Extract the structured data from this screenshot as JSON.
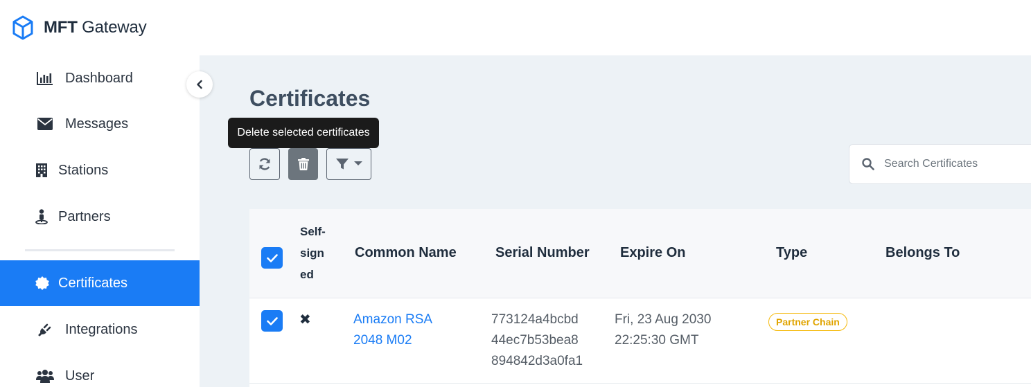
{
  "app": {
    "brand_bold": "MFT",
    "brand_rest": " Gateway"
  },
  "sidebar": {
    "items": [
      {
        "label": "Dashboard",
        "icon": "bar-chart-icon"
      },
      {
        "label": "Messages",
        "icon": "envelope-icon"
      },
      {
        "label": "Stations",
        "icon": "building-icon"
      },
      {
        "label": "Partners",
        "icon": "person-pin-icon"
      },
      {
        "label": "Certificates",
        "icon": "certificate-icon",
        "active": true
      },
      {
        "label": "Integrations",
        "icon": "plug-icon"
      },
      {
        "label": "User",
        "icon": "users-icon"
      }
    ]
  },
  "main": {
    "title": "Certificates",
    "tooltip": "Delete selected certificates",
    "search_placeholder": "Search Certificates"
  },
  "table": {
    "columns": {
      "self_signed": [
        "Self-",
        "sign",
        "ed"
      ],
      "common_name": "Common Name",
      "serial_number": "Serial Number",
      "expire_on": "Expire On",
      "type": "Type",
      "belongs_to": "Belongs To"
    },
    "rows": [
      {
        "selected": true,
        "self_signed": "✖",
        "common_name": [
          "Amazon RSA",
          "2048 M02"
        ],
        "serial_number": [
          "773124a4bcbd",
          "44ec7b53bea8",
          "894842d3a0fa1"
        ],
        "expire_on": [
          "Fri, 23 Aug 2030",
          "22:25:30 GMT"
        ],
        "type": "Partner Chain",
        "belongs_to": ""
      }
    ]
  },
  "colors": {
    "accent": "#1a7cf5",
    "badge": "#f5b90a",
    "main_bg": "#edf2f6"
  }
}
